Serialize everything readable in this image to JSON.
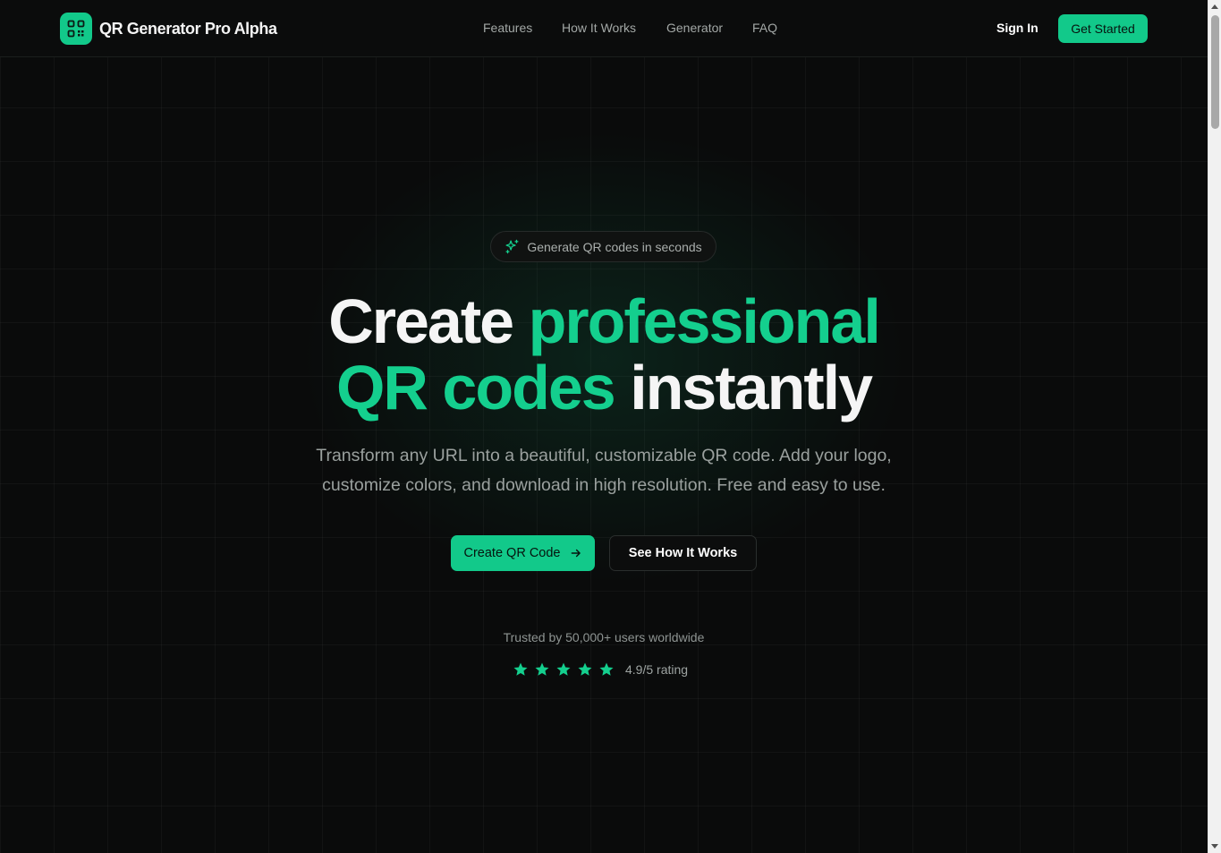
{
  "brand": {
    "name": "QR Generator Pro Alpha",
    "icon": "qr-code-icon",
    "accent": "#12c98a"
  },
  "nav": {
    "items": [
      "Features",
      "How It Works",
      "Generator",
      "FAQ"
    ]
  },
  "header_actions": {
    "sign_in": "Sign In",
    "get_started": "Get Started"
  },
  "hero": {
    "badge": {
      "icon": "sparkles-icon",
      "text": "Generate QR codes in seconds"
    },
    "headline": {
      "line1_white": "Create",
      "line1_green": "professional",
      "line2_green": "QR codes",
      "line2_white": "instantly"
    },
    "subtitle_line1": "Transform any URL into a beautiful, customizable QR code. Add your logo,",
    "subtitle_line2": "customize colors, and download in high resolution. Free and easy to use.",
    "primary_button": {
      "label": "Create QR Code",
      "icon": "arrow-right-icon"
    },
    "secondary_button": {
      "label": "See How It Works"
    },
    "trusted": "Trusted by 50,000+ users worldwide",
    "rating": {
      "stars": 5,
      "filled_stars": 5,
      "text": "4.9/5 rating"
    }
  }
}
